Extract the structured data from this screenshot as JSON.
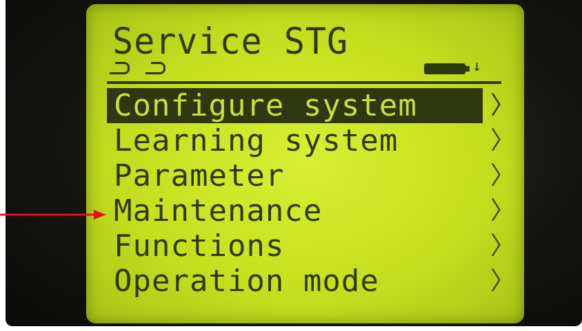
{
  "header": {
    "title": "Service STG"
  },
  "status": {
    "icons": [
      "hook-icon",
      "hook-icon",
      "battery-icon",
      "down-arrow-icon"
    ],
    "down_arrow": "↓"
  },
  "menu": {
    "items": [
      {
        "label": "Configure system",
        "selected": true
      },
      {
        "label": "Learning system",
        "selected": false
      },
      {
        "label": "Parameter",
        "selected": false
      },
      {
        "label": "Maintenance",
        "selected": false
      },
      {
        "label": "Functions",
        "selected": false
      },
      {
        "label": "Operation mode",
        "selected": false
      }
    ],
    "chevron": "〉"
  },
  "annotation": {
    "arrow_color": "#e0141a",
    "points_to": "Maintenance"
  },
  "colors": {
    "lcd_background": "#c6e020",
    "lcd_text": "#2d3a10",
    "selection": "#2f3812"
  }
}
